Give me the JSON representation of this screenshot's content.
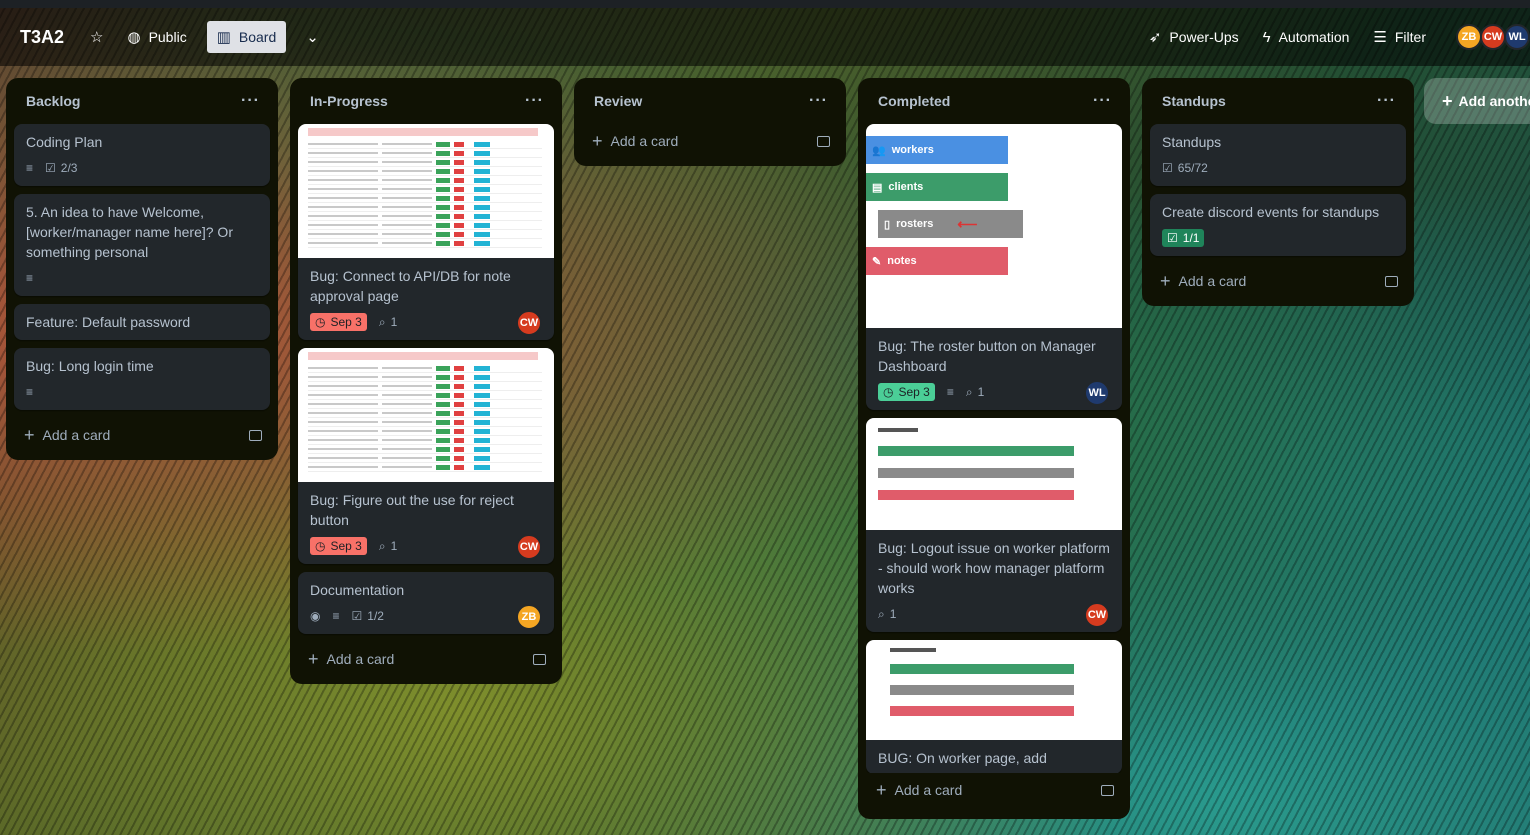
{
  "board": {
    "title": "T3A2",
    "visibility": "Public",
    "view": "Board",
    "power_ups": "Power-Ups",
    "automation": "Automation",
    "filter": "Filter",
    "members": [
      "ZB",
      "CW",
      "WL"
    ]
  },
  "add_card_label": "Add a card",
  "add_list_label": "Add another list",
  "lists": [
    {
      "title": "Backlog",
      "cards": [
        {
          "title": "Coding Plan",
          "checklist": "2/3"
        },
        {
          "title": "5. An idea to have Welcome, [worker/manager name here]? Or something personal"
        },
        {
          "title": "Feature: Default password"
        },
        {
          "title": "Bug: Long login time"
        }
      ]
    },
    {
      "title": "In-Progress",
      "cards": [
        {
          "title": "Bug: Connect to API/DB for note approval page",
          "due": "Sep 3",
          "attachments": "1",
          "member": "CW"
        },
        {
          "title": "Bug: Figure out the use for reject button",
          "due": "Sep 3",
          "attachments": "1",
          "member": "CW"
        },
        {
          "title": "Documentation",
          "checklist": "1/2",
          "member": "ZB"
        }
      ]
    },
    {
      "title": "Review",
      "cards": []
    },
    {
      "title": "Completed",
      "cards": [
        {
          "title": "Bug: The roster button on Manager Dashboard",
          "due": "Sep 3",
          "attachments": "1",
          "member": "WL",
          "cover_items": [
            "workers",
            "clients",
            "rosters",
            "notes"
          ]
        },
        {
          "title": "Bug: Logout issue on worker platform - should work how manager platform works",
          "attachments": "1",
          "member": "CW"
        },
        {
          "title": "BUG: On worker page, add"
        }
      ]
    },
    {
      "title": "Standups",
      "cards": [
        {
          "title": "Standups",
          "checklist": "65/72"
        },
        {
          "title": "Create discord events for standups",
          "checklist": "1/1"
        }
      ]
    }
  ],
  "colors": {
    "list_bg": "#101204",
    "card_bg": "#22272b",
    "due_red": "#f87168",
    "due_green": "#4bce97",
    "check_green": "#1f845a"
  }
}
